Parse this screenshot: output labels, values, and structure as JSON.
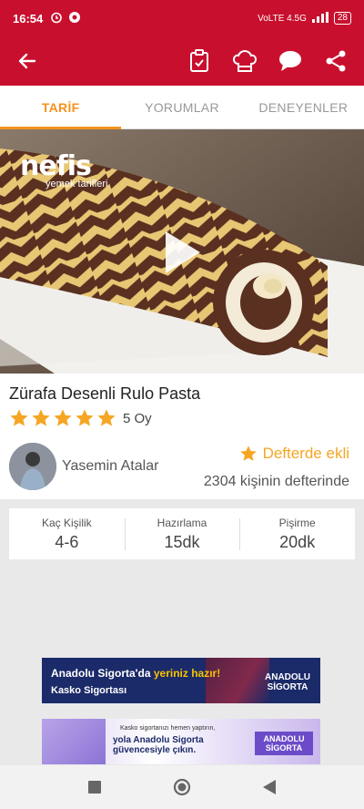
{
  "status": {
    "time": "16:54",
    "battery": "28",
    "network": "VoLTE 4.5G"
  },
  "tabs": [
    {
      "label": "TARİF",
      "active": true
    },
    {
      "label": "YORUMLAR",
      "active": false
    },
    {
      "label": "DENEYENLER",
      "active": false
    }
  ],
  "hero": {
    "brand": "nefis",
    "brand_sub": "yemek tarifleri"
  },
  "recipe": {
    "title": "Zürafa Desenli Rulo Pasta",
    "stars": 5,
    "votes": "5 Oy",
    "author": "Yasemin Atalar",
    "notebook_label": "Defterde ekli",
    "notebook_count": "2304 kişinin defterinde"
  },
  "stats": [
    {
      "label": "Kaç Kişilik",
      "value": "4-6"
    },
    {
      "label": "Hazırlama",
      "value": "15dk"
    },
    {
      "label": "Pişirme",
      "value": "20dk"
    }
  ],
  "ads": {
    "ad1_line1_a": "Anadolu Sigorta'da ",
    "ad1_line1_b": "yeriniz hazır!",
    "ad1_line2": "Kasko Sigortası",
    "ad1_brand": "ANADOLU SİGORTA",
    "ad2_line1": "Kasko sigortanızı hemen yaptırın,",
    "ad2_line2": "yola Anadolu Sigorta",
    "ad2_line3": "güvencesiyle çıkın.",
    "ad2_brand": "ANADOLU SİGORTA"
  },
  "colors": {
    "primary": "#c8102e",
    "accent": "#f5921e",
    "star": "#f5a623"
  }
}
